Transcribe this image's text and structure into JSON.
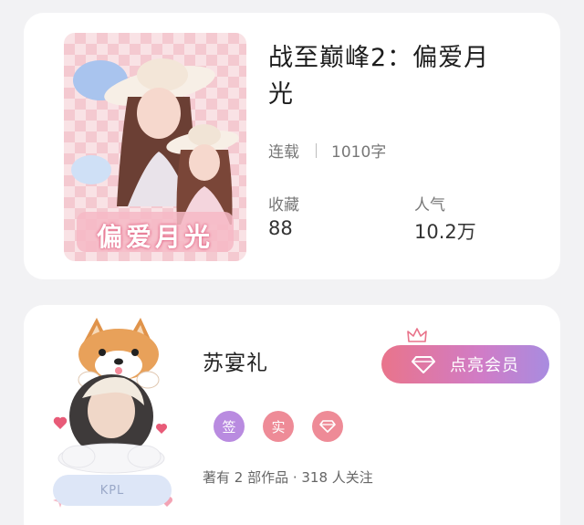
{
  "book": {
    "title": "战至巅峰2：偏爱月光",
    "status": "连载",
    "word_count": "1010字",
    "favorites_label": "收藏",
    "favorites_value": "88",
    "popularity_label": "人气",
    "popularity_value": "10.2万",
    "cover_text": "偏爱月光"
  },
  "author": {
    "name": "苏宴礼",
    "vip_button": "点亮会员",
    "badge_sign": "签",
    "badge_real": "实",
    "works_info": "著有 2 部作品 · 318 人关注",
    "frame_label": "KPL"
  },
  "colors": {
    "background": "#f2f2f4",
    "card": "#ffffff",
    "badge_sign": "#b98be0",
    "badge_real": "#ee8b97",
    "badge_vip": "#ee8b97",
    "vip_gradient_start": "#e9748b",
    "vip_gradient_end": "#a88ce0"
  },
  "icons": {
    "vip_icon": "diamond-icon",
    "crown": "crown-icon",
    "badge_vip": "diamond-icon"
  }
}
